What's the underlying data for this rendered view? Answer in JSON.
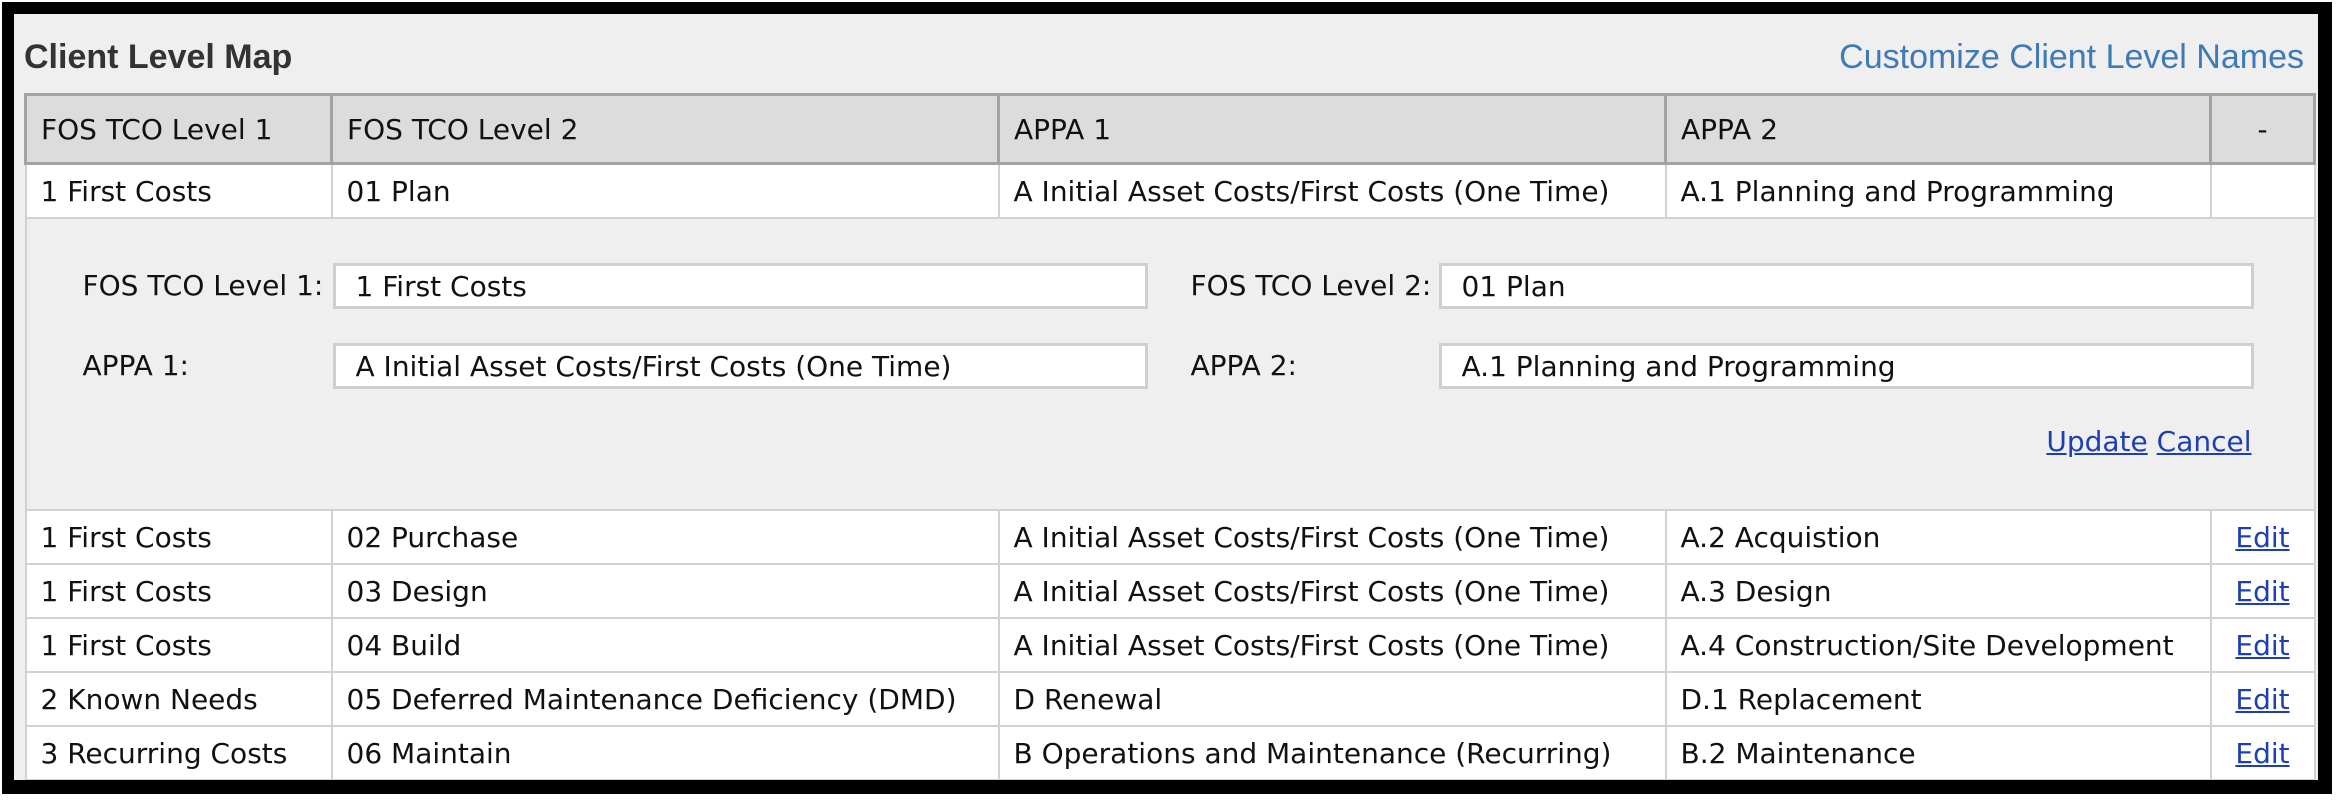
{
  "page": {
    "title": "Client Level Map",
    "customize_link": "Customize Client Level Names"
  },
  "table": {
    "headers": [
      "FOS TCO Level 1",
      "FOS TCO Level 2",
      "APPA 1",
      "APPA 2",
      "-"
    ],
    "editing_row": {
      "cells": [
        "1 First Costs",
        "01 Plan",
        "A Initial Asset Costs/First Costs (One Time)",
        "A.1 Planning and Programming",
        ""
      ],
      "form": {
        "fos_tco_level_1_label": "FOS TCO Level 1:",
        "fos_tco_level_1_value": "1 First Costs",
        "fos_tco_level_2_label": "FOS TCO Level 2:",
        "fos_tco_level_2_value": "01 Plan",
        "appa_1_label": "APPA 1:",
        "appa_1_value": "A Initial Asset Costs/First Costs (One Time)",
        "appa_2_label": "APPA 2:",
        "appa_2_value": "A.1 Planning and Programming",
        "update_label": "Update",
        "cancel_label": "Cancel"
      }
    },
    "rows": [
      {
        "level1": "1 First Costs",
        "level2": "02 Purchase",
        "appa1": "A Initial Asset Costs/First Costs (One Time)",
        "appa2": "A.2 Acquistion",
        "action": "Edit"
      },
      {
        "level1": "1 First Costs",
        "level2": "03 Design",
        "appa1": "A Initial Asset Costs/First Costs (One Time)",
        "appa2": "A.3 Design",
        "action": "Edit"
      },
      {
        "level1": "1 First Costs",
        "level2": "04 Build",
        "appa1": "A Initial Asset Costs/First Costs (One Time)",
        "appa2": "A.4 Construction/Site Development",
        "action": "Edit"
      },
      {
        "level1": "2 Known Needs",
        "level2": "05 Deferred Maintenance Deficiency (DMD)",
        "appa1": "D Renewal",
        "appa2": "D.1 Replacement",
        "action": "Edit"
      },
      {
        "level1": "3 Recurring Costs",
        "level2": "06 Maintain",
        "appa1": "B Operations and Maintenance (Recurring)",
        "appa2": "B.2 Maintenance",
        "action": "Edit"
      }
    ]
  },
  "colors": {
    "link_header": "#3f7ab8",
    "link": "#1e3fb3",
    "header_bg": "#dcdcdc",
    "panel_bg": "#efefef"
  }
}
